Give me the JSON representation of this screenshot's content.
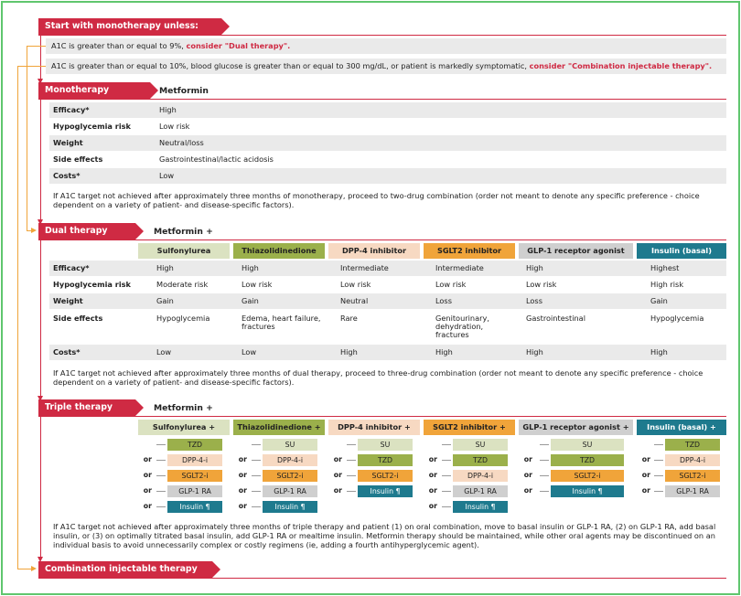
{
  "start": {
    "title": "Start with monotherapy unless:",
    "cond1_text": "A1C is greater than or equal to 9%,",
    "cond1_link": "consider \"Dual therapy\".",
    "cond2_text": "A1C is greater than or equal to 10%, blood glucose is greater than or equal to 300 mg/dL, or patient is markedly symptomatic,",
    "cond2_link": "consider \"Combination injectable therapy\"."
  },
  "mono": {
    "title": "Monotherapy",
    "drug": "Metformin",
    "rows": [
      {
        "label": "Efficacy*",
        "value": "High"
      },
      {
        "label": "Hypoglycemia risk",
        "value": "Low risk"
      },
      {
        "label": "Weight",
        "value": "Neutral/loss"
      },
      {
        "label": "Side effects",
        "value": "Gastrointestinal/lactic acidosis"
      },
      {
        "label": "Costs*",
        "value": "Low"
      }
    ],
    "note": "If A1C target not achieved after approximately three months of monotherapy, proceed to two-drug combination (order not meant to denote any specific preference - choice dependent on a variety of patient- and disease-specific factors)."
  },
  "dual": {
    "title": "Dual therapy",
    "base": "Metformin +",
    "columns": [
      "Sulfonylurea",
      "Thiazolidinedione",
      "DPP-4 inhibitor",
      "SGLT2 inhibitor",
      "GLP-1 receptor agonist",
      "Insulin (basal)"
    ],
    "rows": [
      {
        "label": "Efficacy*",
        "values": [
          "High",
          "High",
          "Intermediate",
          "Intermediate",
          "High",
          "Highest"
        ]
      },
      {
        "label": "Hypoglycemia risk",
        "values": [
          "Moderate risk",
          "Low risk",
          "Low risk",
          "Low risk",
          "Low risk",
          "High risk"
        ]
      },
      {
        "label": "Weight",
        "values": [
          "Gain",
          "Gain",
          "Neutral",
          "Loss",
          "Loss",
          "Gain"
        ]
      },
      {
        "label": "Side effects",
        "values": [
          "Hypoglycemia",
          "Edema, heart failure,",
          "Rare",
          "Genitourinary,",
          "Gastrointestinal",
          "Hypoglycemia"
        ],
        "values2": [
          "",
          "fractures",
          "",
          "dehydration,",
          "",
          ""
        ],
        "values3": [
          "",
          "",
          "",
          "fractures",
          "",
          ""
        ]
      },
      {
        "label": "Costs*",
        "values": [
          "Low",
          "Low",
          "High",
          "High",
          "High",
          "High"
        ]
      }
    ],
    "note": "If A1C target not achieved after approximately three months of dual therapy, proceed to three-drug combination (order not meant to denote any specific preference - choice dependent on a variety of patient- and disease-specific factors)."
  },
  "triple": {
    "title": "Triple therapy",
    "base": "Metformin +",
    "or": "or",
    "columns": [
      "Sulfonylurea +",
      "Thiazolidinedione +",
      "DPP-4 inhibitor +",
      "SGLT2 inhibitor +",
      "GLP-1 receptor agonist +",
      "Insulin (basal) +"
    ],
    "options": [
      [
        "TZD",
        "DPP-4-i",
        "SGLT2-i",
        "GLP-1 RA",
        "Insulin ¶"
      ],
      [
        "SU",
        "DPP-4-i",
        "SGLT2-i",
        "GLP-1 RA",
        "Insulin ¶"
      ],
      [
        "SU",
        "TZD",
        "SGLT2-i",
        "Insulin ¶"
      ],
      [
        "SU",
        "TZD",
        "DPP-4-i",
        "GLP-1 RA",
        "Insulin ¶"
      ],
      [
        "SU",
        "TZD",
        "SGLT2-i",
        "Insulin ¶"
      ],
      [
        "TZD",
        "DPP-4-i",
        "SGLT2-i",
        "GLP-1 RA"
      ]
    ],
    "note": "If A1C target not achieved after approximately three months of triple therapy and patient (1) on oral combination, move to basal insulin or GLP-1 RA, (2) on GLP-1 RA, add basal insulin, or (3) on optimally titrated basal insulin, add GLP-1 RA or mealtime insulin. Metformin therapy should be maintained, while other oral agents may be discontinued on an individual basis to avoid unnecessarily complex or costly regimens (ie, adding a fourth antihyperglycemic agent)."
  },
  "combo": {
    "title": "Combination injectable therapy"
  },
  "colors": {
    "red": "#cf2a43",
    "orange": "#f0a43a",
    "green": "#5fc66e",
    "su": "#dbe2c1",
    "tzd": "#9bb04b",
    "dpp": "#f7d9c2",
    "sglt": "#f0a43a",
    "glp": "#cfcfcf",
    "insulin": "#1e7a8e"
  }
}
